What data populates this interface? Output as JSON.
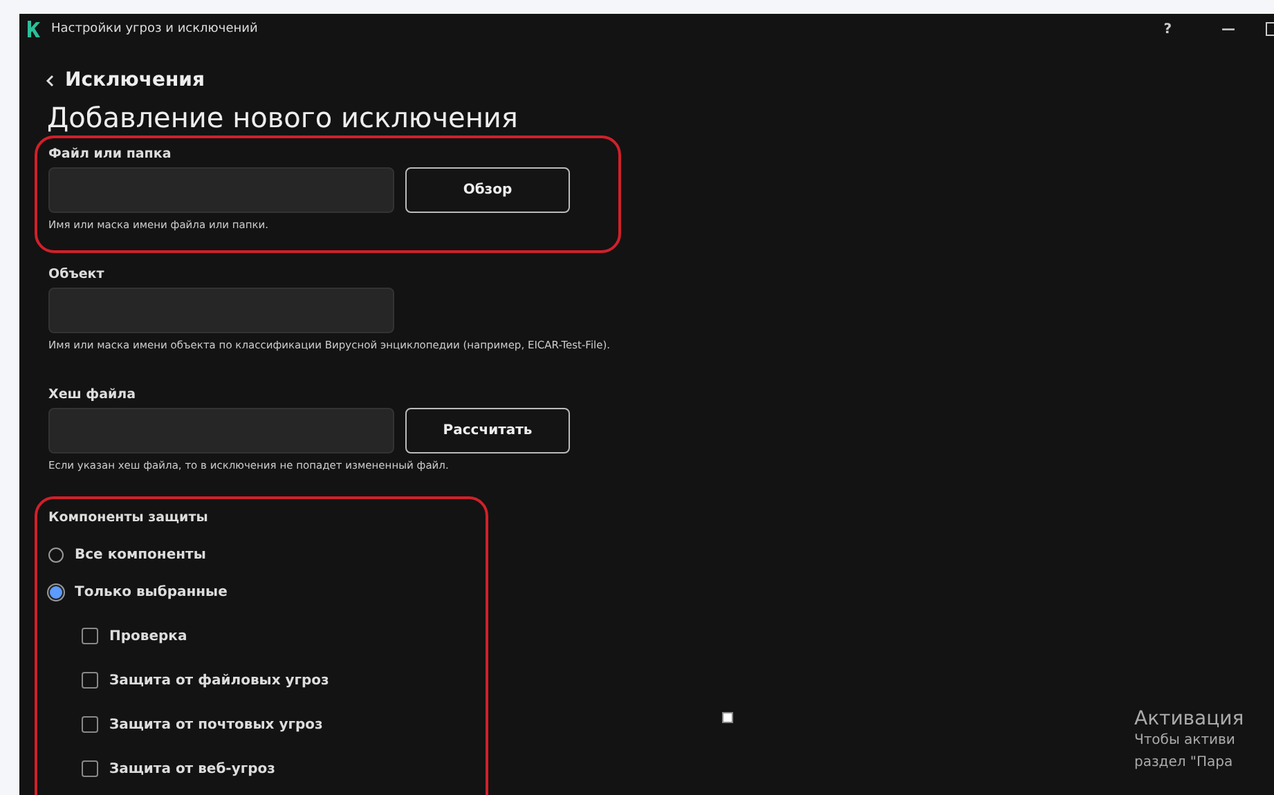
{
  "window": {
    "title": "Настройки угроз и исключений",
    "controls": [
      "?",
      "—"
    ]
  },
  "back_link": "Исключения",
  "heading": "Добавление нового исключения",
  "file_or_folder": {
    "label": "Файл или папка",
    "button": "Обзор",
    "hint": "Имя или маска имени файла или папки.",
    "highlighted": true
  },
  "object": {
    "label": "Объект",
    "hint": "Имя или маска имени объекта по классификации Вирусной энциклопедии (например, EICAR-Test-File)."
  },
  "file_hash": {
    "label": "Хеш файла",
    "button": "Рассчитать",
    "hint": "Если указан хеш файла, то в исключения не попадет измененный файл."
  },
  "components": {
    "label": "Компоненты защиты",
    "highlighted": true,
    "options": [
      {
        "label": "Все компоненты",
        "selected": false
      },
      {
        "label": "Только выбранные",
        "selected": true
      }
    ],
    "items": [
      {
        "label": "Проверка",
        "checked": false
      },
      {
        "label": "Защита от файловых угроз",
        "checked": false
      },
      {
        "label": "Защита от почтовых угроз",
        "checked": false
      },
      {
        "label": "Защита от веб-угроз",
        "checked": false
      }
    ]
  },
  "activation_notice": {
    "title": "Активация",
    "lines": [
      "Чтобы активи",
      "раздел \"Пара"
    ]
  }
}
